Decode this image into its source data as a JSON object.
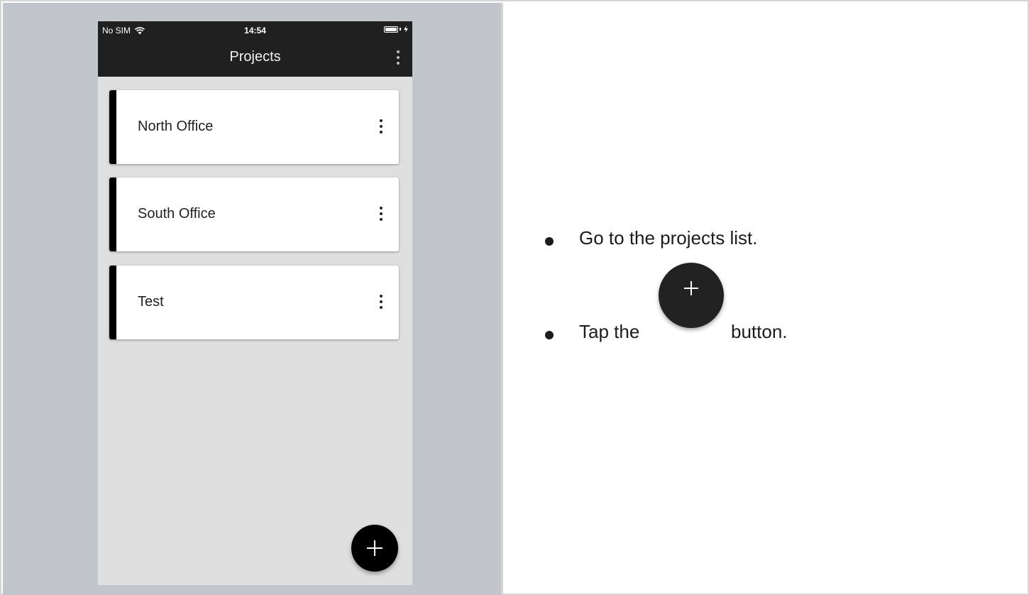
{
  "status_bar": {
    "carrier": "No SIM",
    "time": "14:54",
    "wifi_icon": "wifi-icon",
    "battery_icon": "battery-charging-icon"
  },
  "app_bar": {
    "title": "Projects",
    "menu_icon": "more-vert-icon"
  },
  "projects": [
    {
      "name": "North Office"
    },
    {
      "name": "South Office"
    },
    {
      "name": "Test"
    }
  ],
  "fab": {
    "icon": "plus-icon"
  },
  "instructions": {
    "step1": "Go to the projects list.",
    "step2_before": "Tap the",
    "step2_after": "button."
  },
  "colors": {
    "app_bar": "#202020",
    "card_accent": "#000000",
    "fab": "#000000",
    "side_panel": "#c1c6cd",
    "phone_background": "#dfdfdf"
  }
}
